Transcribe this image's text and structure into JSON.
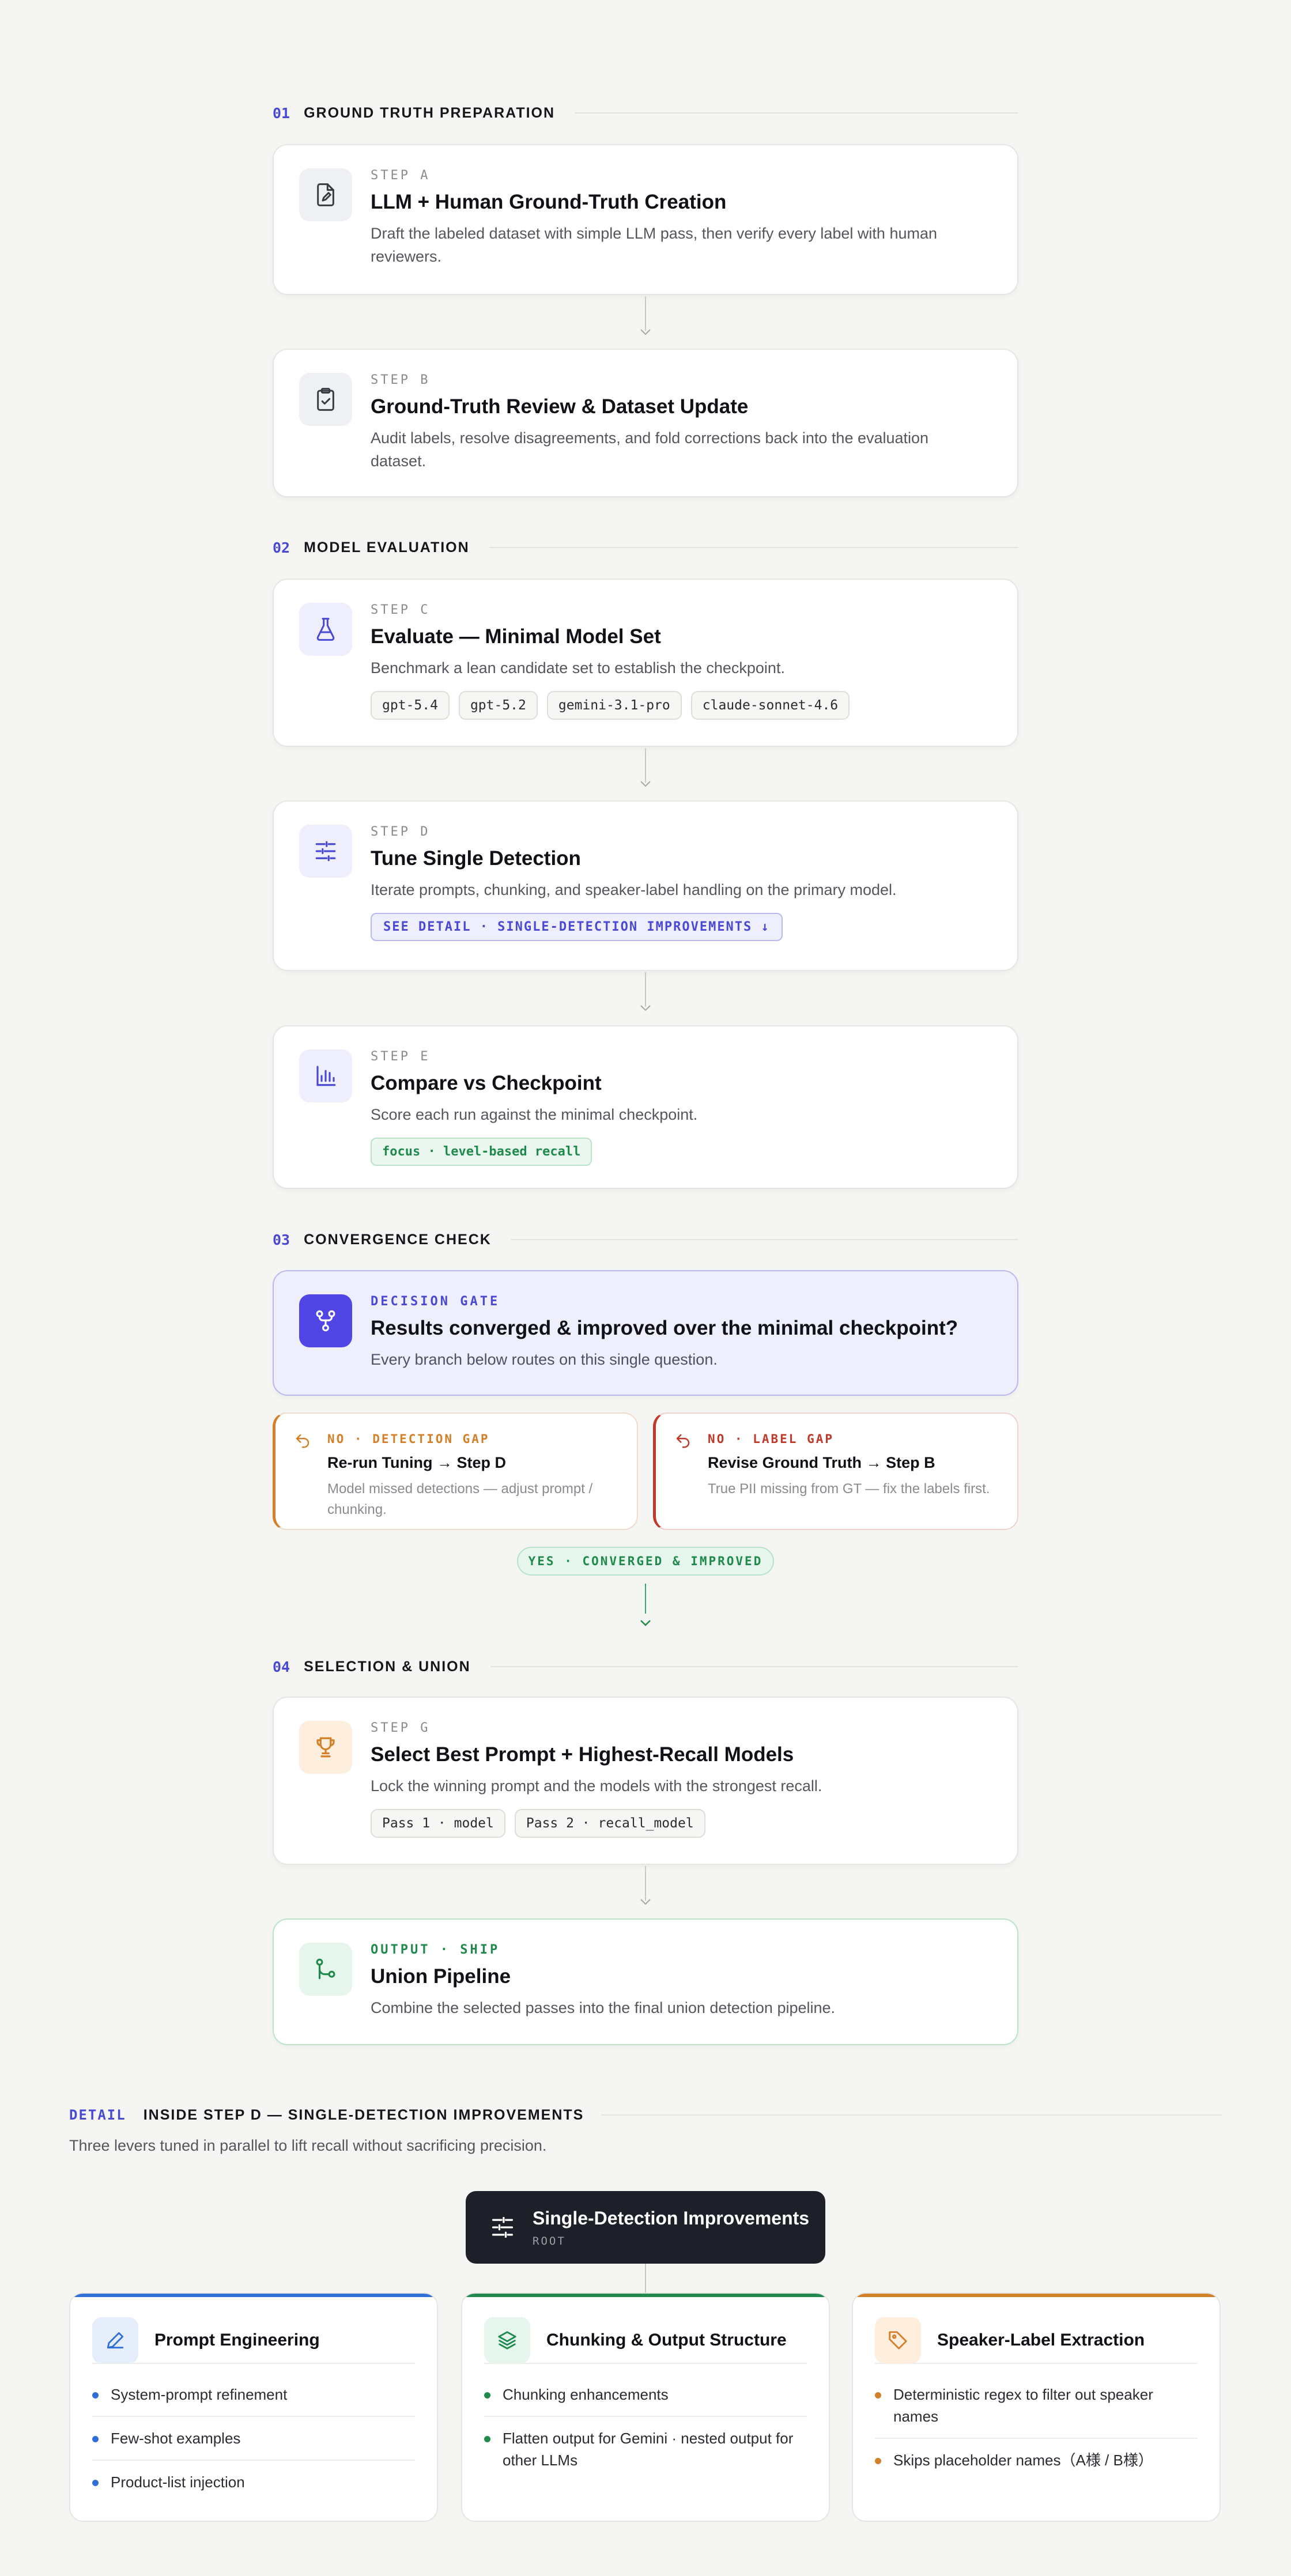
{
  "sections": [
    {
      "num": "01",
      "title": "GROUND TRUTH PREPARATION"
    },
    {
      "num": "02",
      "title": "MODEL EVALUATION"
    },
    {
      "num": "03",
      "title": "CONVERGENCE CHECK"
    },
    {
      "num": "04",
      "title": "SELECTION & UNION"
    }
  ],
  "steps": {
    "a": {
      "kicker": "STEP A",
      "title": "LLM + Human Ground-Truth Creation",
      "desc": "Draft the labeled dataset with simple LLM pass, then verify every label with human reviewers."
    },
    "b": {
      "kicker": "STEP B",
      "title": "Ground-Truth Review & Dataset Update",
      "desc": "Audit labels, resolve disagreements, and fold corrections back into the evaluation dataset."
    },
    "c": {
      "kicker": "STEP C",
      "title": "Evaluate — Minimal Model Set",
      "desc": "Benchmark a lean candidate set to establish the checkpoint.",
      "chips": [
        "gpt-5.4",
        "gpt-5.2",
        "gemini-3.1-pro",
        "claude-sonnet-4.6"
      ]
    },
    "d": {
      "kicker": "STEP D",
      "title": "Tune Single Detection",
      "desc": "Iterate prompts, chunking, and speaker-label handling on the primary model.",
      "link": "SEE DETAIL · SINGLE-DETECTION IMPROVEMENTS ↓"
    },
    "e": {
      "kicker": "STEP E",
      "title": "Compare vs Checkpoint",
      "desc": "Score each run against the minimal checkpoint.",
      "tag": "focus · level-based recall"
    },
    "gate": {
      "kicker": "DECISION GATE",
      "title": "Results converged & improved over the minimal checkpoint?",
      "desc": "Every branch below routes on this single question."
    },
    "g": {
      "kicker": "STEP G",
      "title": "Select Best Prompt + Highest-Recall Models",
      "desc": "Lock the winning prompt and the models with the strongest recall.",
      "chips": [
        "Pass 1 · model",
        "Pass 2 · recall_model"
      ]
    },
    "out": {
      "kicker": "OUTPUT · SHIP",
      "title": "Union Pipeline",
      "desc": "Combine the selected passes into the final union detection pipeline."
    }
  },
  "branches": {
    "left": {
      "kicker": "NO · DETECTION GAP",
      "title_a": "Re-run Tuning",
      "arrow": "→",
      "title_b": "Step D",
      "desc": "Model missed detections — adjust prompt / chunking.",
      "color": "#d4802a"
    },
    "right": {
      "kicker": "NO · LABEL GAP",
      "title_a": "Revise Ground Truth",
      "arrow": "→",
      "title_b": "Step B",
      "desc": "True PII missing from GT — fix the labels first.",
      "color": "#c0392b"
    }
  },
  "yes_pill": "YES · CONVERGED & IMPROVED",
  "detail": {
    "label": "DETAIL",
    "title": "INSIDE STEP D — SINGLE-DETECTION IMPROVEMENTS",
    "subtitle": "Three levers tuned in parallel to lift recall without sacrificing precision.",
    "root": {
      "title": "Single-Detection Improvements",
      "sub": "ROOT"
    },
    "cards": [
      {
        "title": "Prompt Engineering",
        "color": "#2f6fd6",
        "items": [
          "System-prompt refinement",
          "Few-shot examples",
          "Product-list injection"
        ]
      },
      {
        "title": "Chunking & Output Structure",
        "color": "#1f8a4c",
        "items": [
          "Chunking enhancements",
          "Flatten output for Gemini · nested output for other LLMs"
        ]
      },
      {
        "title": "Speaker-Label Extraction",
        "color": "#d4802a",
        "items": [
          "Deterministic regex to filter out speaker names",
          "Skips placeholder names（A様 / B様）"
        ]
      }
    ]
  },
  "icons": {
    "a": "file-edit-icon",
    "b": "clipboard-check-icon",
    "c": "flask-icon",
    "d": "sliders-icon",
    "e": "bar-chart-icon",
    "gate": "git-fork-icon",
    "g": "trophy-icon",
    "out": "git-branch-icon",
    "root": "sliders-icon",
    "prompt": "pencil-icon",
    "chunk": "layers-icon",
    "speaker": "tag-icon",
    "left": "undo-arrow-icon",
    "right": "undo-arrow-icon"
  }
}
